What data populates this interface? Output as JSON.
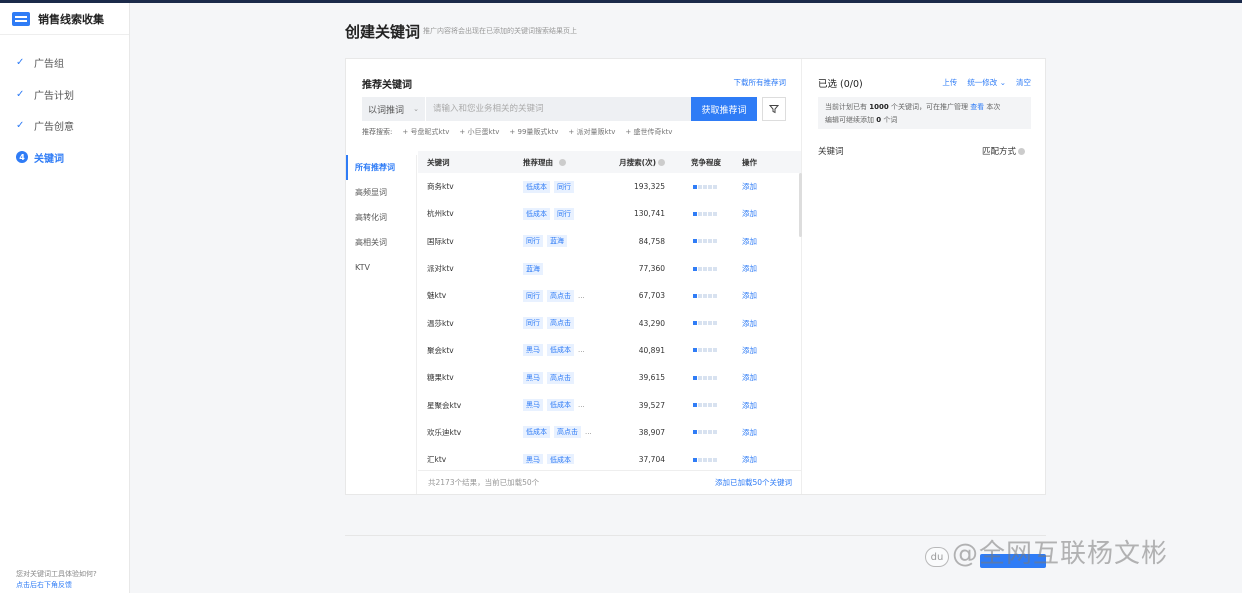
{
  "app": {
    "title": "销售线索收集"
  },
  "steps": [
    {
      "label": "广告组",
      "done": true
    },
    {
      "label": "广告计划",
      "done": true
    },
    {
      "label": "广告创意",
      "done": true
    },
    {
      "label": "关键词",
      "number": "4",
      "active": true
    }
  ],
  "feedback": {
    "question": "您对关键词工具体验如何?",
    "link": "点击后右下角反馈"
  },
  "header": {
    "title": "创建关键词",
    "subtitle": "推广内容将会出现在已添加的关键词搜索结果页上"
  },
  "recommend": {
    "title": "推荐关键词",
    "download_link": "下载所有推荐词",
    "select_value": "以词推词",
    "search_placeholder": "请输入和您业务相关的关键词",
    "get_button": "获取推荐词",
    "suggest_label": "推荐搜索:",
    "suggestions": [
      "+ 号盘昵式ktv",
      "+ 小巨蛋ktv",
      "+ 99量贩式ktv",
      "+ 派对量贩ktv",
      "+ 盛世传奇ktv"
    ]
  },
  "categories": [
    {
      "label": "所有推荐词",
      "active": true
    },
    {
      "label": "高频显词"
    },
    {
      "label": "高转化词"
    },
    {
      "label": "高相关词"
    },
    {
      "label": "KTV"
    }
  ],
  "table": {
    "headers": {
      "keyword": "关键词",
      "reason": "推荐理由",
      "monthly": "月搜索(次)",
      "competition": "竞争程度",
      "action": "操作"
    },
    "rows": [
      {
        "keyword": "商务ktv",
        "tags": [
          "低成本",
          "同行"
        ],
        "more": false,
        "monthly": "193,325",
        "level": 1,
        "action": "添加"
      },
      {
        "keyword": "杭州ktv",
        "tags": [
          "低成本",
          "同行"
        ],
        "more": false,
        "monthly": "130,741",
        "level": 1,
        "action": "添加"
      },
      {
        "keyword": "国际ktv",
        "tags": [
          "同行",
          "蓝海"
        ],
        "more": false,
        "monthly": "84,758",
        "level": 1,
        "action": "添加"
      },
      {
        "keyword": "派对ktv",
        "tags": [
          "蓝海"
        ],
        "more": false,
        "monthly": "77,360",
        "level": 1,
        "action": "添加"
      },
      {
        "keyword": "魅ktv",
        "tags": [
          "同行",
          "高点击"
        ],
        "more": true,
        "monthly": "67,703",
        "level": 1,
        "action": "添加"
      },
      {
        "keyword": "温莎ktv",
        "tags": [
          "同行",
          "高点击"
        ],
        "more": false,
        "monthly": "43,290",
        "level": 1,
        "action": "添加"
      },
      {
        "keyword": "聚会ktv",
        "tags": [
          "黑马",
          "低成本"
        ],
        "more": true,
        "monthly": "40,891",
        "level": 1,
        "action": "添加"
      },
      {
        "keyword": "糖果ktv",
        "tags": [
          "黑马",
          "高点击"
        ],
        "more": false,
        "monthly": "39,615",
        "level": 1,
        "action": "添加"
      },
      {
        "keyword": "星聚会ktv",
        "tags": [
          "黑马",
          "低成本"
        ],
        "more": true,
        "monthly": "39,527",
        "level": 1,
        "action": "添加"
      },
      {
        "keyword": "欢乐迪ktv",
        "tags": [
          "低成本",
          "高点击"
        ],
        "more": true,
        "monthly": "38,907",
        "level": 1,
        "action": "添加"
      },
      {
        "keyword": "汇ktv",
        "tags": [
          "黑马",
          "低成本"
        ],
        "more": false,
        "monthly": "37,704",
        "level": 1,
        "action": "添加"
      }
    ],
    "total_text": "共2173个结果，当前已加载50个",
    "add_all": "添加已加载50个关键词"
  },
  "selected": {
    "title": "已选",
    "count": "(0/0)",
    "actions": [
      "上传",
      "统一修改",
      "清空"
    ],
    "notice_prefix": "当前计划已有",
    "notice_count": "1000",
    "notice_mid": "个关键词，可在推广管理",
    "notice_link": "查看",
    "notice_suffix": "本次",
    "notice_line2a": "编辑可继续添加",
    "notice_remaining": "0",
    "notice_line2b": "个词",
    "col_keyword": "关键词",
    "col_match": "匹配方式"
  },
  "watermark": {
    "text": "@全网互联杨文彬",
    "badge": "du"
  },
  "colors": {
    "accent": "#2f7cf6",
    "tag_bg": "#e8f1ff"
  }
}
